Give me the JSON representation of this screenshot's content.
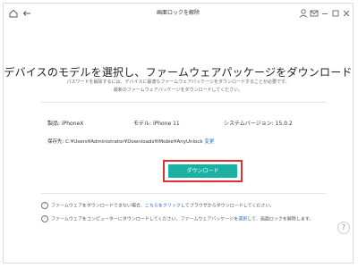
{
  "window": {
    "title": "画面ロックを解除",
    "icons": [
      "home-icon",
      "back-arrow-icon",
      "user-icon",
      "mail-icon",
      "minimize-icon",
      "maximize-icon",
      "close-icon"
    ]
  },
  "main": {
    "heading": "デバイスのモデルを選択し、ファームウェアパッケージをダウンロード",
    "subtitle_1": "パスワードを解除するには、デバイスに最適なファームウェアパッケージをダウンロードすることが必要です。",
    "subtitle_2": "最新のファームウェアパッケージをダウンロードしてください。"
  },
  "device": {
    "product_label": "製品:",
    "product_value": "iPhoneX",
    "model_label": "モデル:",
    "model_value": "iPhone 11",
    "version_label": "システムバージョン:",
    "version_value": "15.0.2",
    "path_label": "保存先:",
    "path_value": "C:¥Users¥Administrator¥Downloads¥iMobie¥AnyUnlock",
    "change_link": "変更"
  },
  "download_button": {
    "label": "ダウンロード"
  },
  "notes": {
    "note1_before": "ファームウェアをダウンロードできない場合、",
    "note1_link": "こちらをクリック",
    "note1_after": "してブラウザからダウンロードしてください。",
    "note2_before": "ファームウェアをコンピューターにダウンロードしてください。ファームウェアパッケージを",
    "note2_link": "選択",
    "note2_after": "して、画面ロックを解除します。"
  },
  "help": {
    "label": "?"
  },
  "colors": {
    "accent": "#1bb0a2",
    "highlight": "#e0302f",
    "link": "#2a6fdb"
  }
}
